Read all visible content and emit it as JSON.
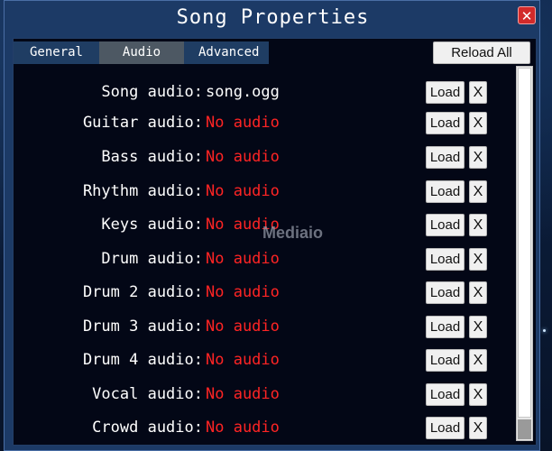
{
  "window": {
    "title": "Song Properties",
    "close_label": "✕"
  },
  "tabs": [
    {
      "label": "General",
      "active": false
    },
    {
      "label": "Audio",
      "active": true
    },
    {
      "label": "Advanced",
      "active": false
    }
  ],
  "reload_all_label": "Reload All",
  "load_label": "Load",
  "clear_label": "X",
  "rows": [
    {
      "label": "Song audio:",
      "value": "song.ogg",
      "status": "set"
    },
    {
      "label": "Guitar audio:",
      "value": "No audio",
      "status": "none"
    },
    {
      "label": "Bass audio:",
      "value": "No audio",
      "status": "none"
    },
    {
      "label": "Rhythm audio:",
      "value": "No audio",
      "status": "none"
    },
    {
      "label": "Keys audio:",
      "value": "No audio",
      "status": "none"
    },
    {
      "label": "Drum audio:",
      "value": "No audio",
      "status": "none"
    },
    {
      "label": "Drum 2 audio:",
      "value": "No audio",
      "status": "none"
    },
    {
      "label": "Drum 3 audio:",
      "value": "No audio",
      "status": "none"
    },
    {
      "label": "Drum 4 audio:",
      "value": "No audio",
      "status": "none"
    },
    {
      "label": "Vocal audio:",
      "value": "No audio",
      "status": "none"
    },
    {
      "label": "Crowd audio:",
      "value": "No audio",
      "status": "none"
    }
  ],
  "watermark": "Mediaio",
  "colors": {
    "missing": "#ff2424",
    "present": "#ffffff",
    "active_tab": "#4d5863"
  },
  "icons": {
    "close": "close-icon"
  }
}
